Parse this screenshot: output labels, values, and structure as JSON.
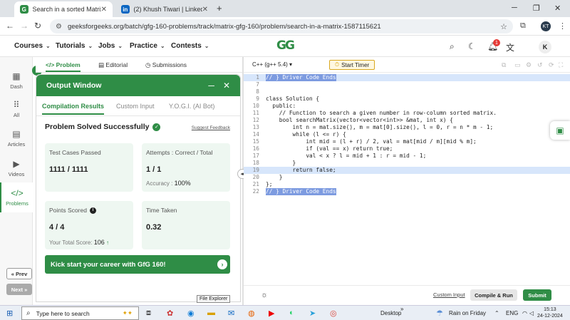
{
  "browser": {
    "tabs": [
      {
        "title": "Search in a sorted Matrix | Prac",
        "favicon": "G",
        "color": "#2f8d46",
        "active": true
      },
      {
        "title": "(2) Khush Tiwari | LinkedIn",
        "favicon": "in",
        "color": "#0a66c2",
        "active": false
      }
    ],
    "url": "geeksforgeeks.org/batch/gfg-160-problems/track/matrix-gfg-160/problem/search-in-a-matrix-1587115621",
    "profile_initial": "KT"
  },
  "header": {
    "menus": [
      "Courses",
      "Tutorials",
      "Jobs",
      "Practice",
      "Contests"
    ],
    "logo": "GG",
    "notification_count": "1",
    "avatar": "K"
  },
  "sidebar": {
    "items": [
      {
        "label": "Dash",
        "icon": "dashboard-icon"
      },
      {
        "label": "All",
        "icon": "grid-icon"
      },
      {
        "label": "Articles",
        "icon": "article-icon"
      },
      {
        "label": "Videos",
        "icon": "video-icon"
      },
      {
        "label": "Problems",
        "icon": "code-icon"
      }
    ],
    "prev": "« Prev",
    "next": "Next »"
  },
  "problem_tabs": [
    "Problem",
    "Editorial",
    "Submissions"
  ],
  "output": {
    "title": "Output Window",
    "tabs": [
      "Compilation Results",
      "Custom Input",
      "Y.O.G.I. (AI Bot)"
    ],
    "status": "Problem Solved Successfully",
    "suggest": "Suggest Feedback",
    "test_cases_label": "Test Cases Passed",
    "test_cases_value": "1111 / 1111",
    "attempts_label": "Attempts : Correct / Total",
    "attempts_value": "1 / 1",
    "accuracy_label": "Accuracy :",
    "accuracy_value": "100%",
    "points_label": "Points Scored",
    "points_value": "4 / 4",
    "total_score_label": "Your Total Score:",
    "total_score_value": "106",
    "time_label": "Time Taken",
    "time_value": "0.32",
    "banner": "Kick start your career with GfG 160!"
  },
  "editor": {
    "language": "C++ (g++ 5.4)",
    "timer": "Start Timer",
    "custom_input": "Custom Input",
    "compile": "Compile & Run",
    "submit": "Submit",
    "tooltip": "File Explorer",
    "lines": [
      {
        "n": "1",
        "text": "// } Driver Code Ends",
        "hl": true,
        "sel": true
      },
      {
        "n": "7",
        "text": "",
        "hl": false
      },
      {
        "n": "8",
        "text": "",
        "hl": false
      },
      {
        "n": "9",
        "text": "class Solution {",
        "hl": false
      },
      {
        "n": "10",
        "text": "  public:",
        "hl": false
      },
      {
        "n": "11",
        "text": "    // Function to search a given number in row-column sorted matrix.",
        "hl": false
      },
      {
        "n": "12",
        "text": "    bool searchMatrix(vector<vector<int>> &mat, int x) {",
        "hl": false
      },
      {
        "n": "13",
        "text": "        int n = mat.size(), m = mat[0].size(), l = 0, r = n * m - 1;",
        "hl": false
      },
      {
        "n": "14",
        "text": "        while (l <= r) {",
        "hl": false
      },
      {
        "n": "15",
        "text": "            int mid = (l + r) / 2, val = mat[mid / m][mid % m];",
        "hl": false
      },
      {
        "n": "16",
        "text": "            if (val == x) return true;",
        "hl": false
      },
      {
        "n": "17",
        "text": "            val < x ? l = mid + 1 : r = mid - 1;",
        "hl": false
      },
      {
        "n": "18",
        "text": "        }",
        "hl": false
      },
      {
        "n": "19",
        "text": "        return false;",
        "hl": true
      },
      {
        "n": "20",
        "text": "    }",
        "hl": false
      },
      {
        "n": "21",
        "text": "};",
        "hl": false
      },
      {
        "n": "22",
        "text": "// } Driver Code Ends",
        "hl": false,
        "sel": true
      }
    ]
  },
  "taskbar": {
    "search": "Type here to search",
    "desktop": "Desktop",
    "weather": "Rain on Friday",
    "lang": "ENG",
    "time": "15:13",
    "date": "24-12-2024"
  }
}
